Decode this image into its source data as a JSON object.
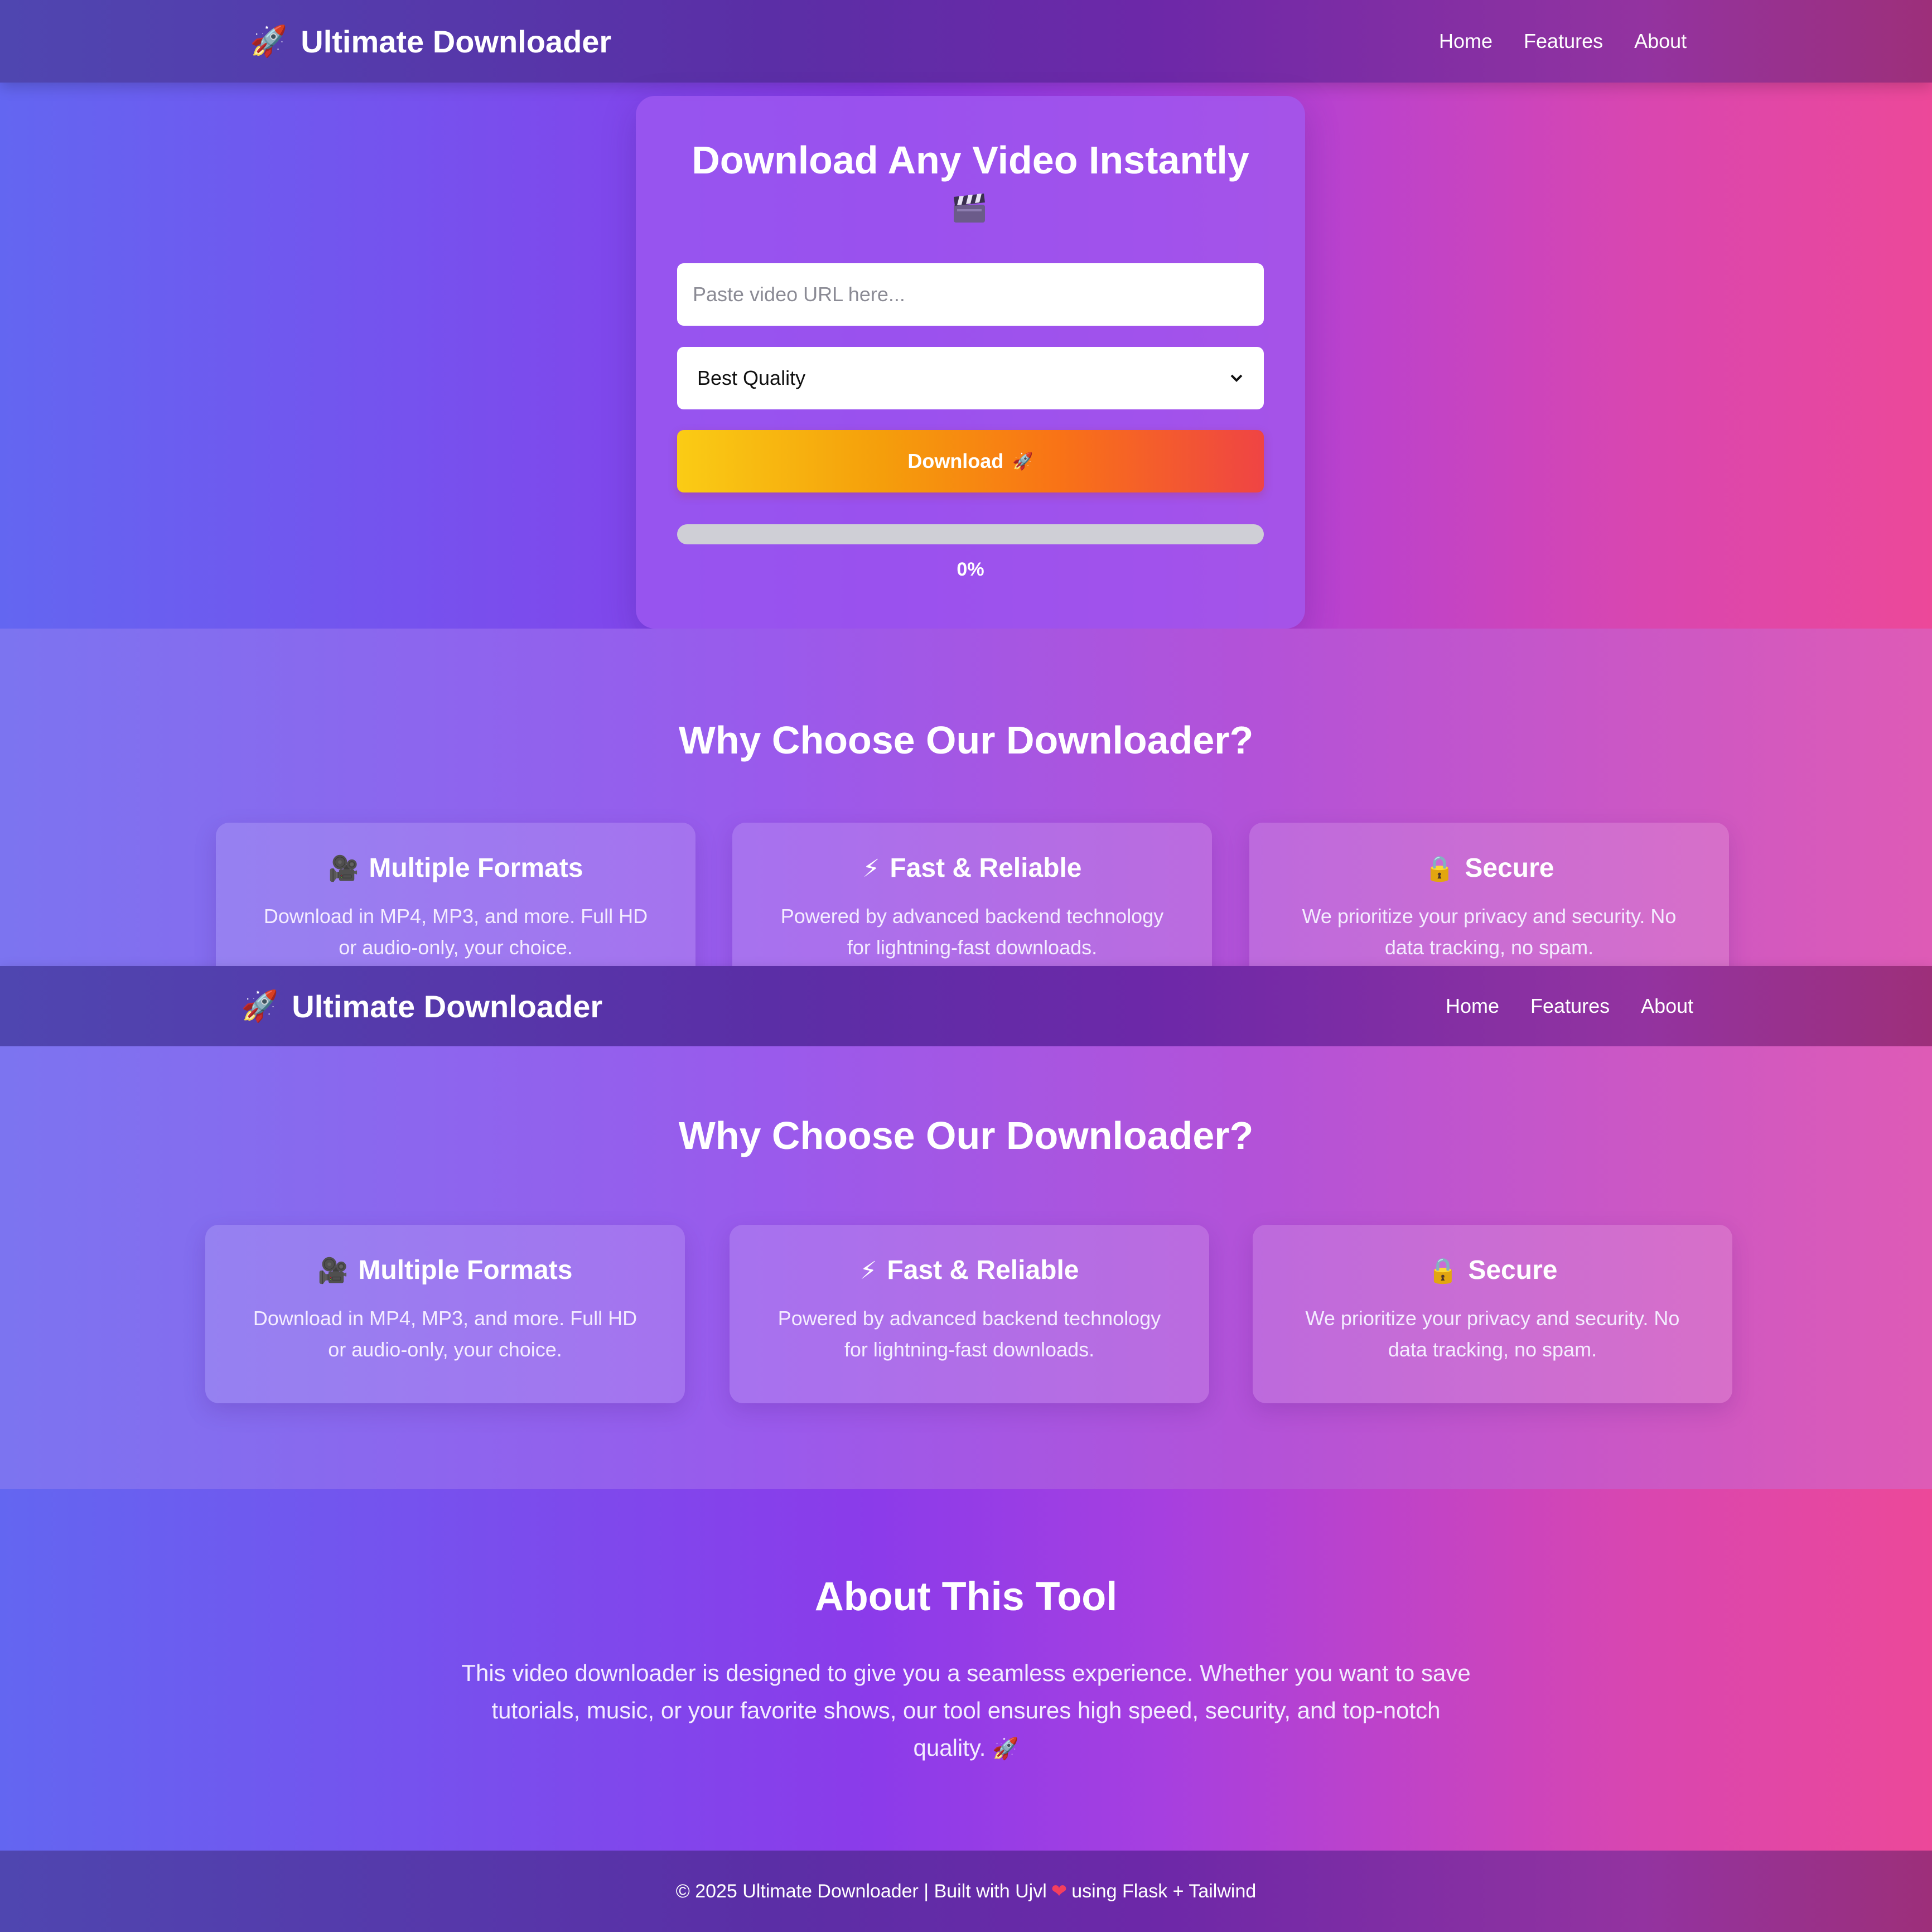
{
  "brand": {
    "name": "Ultimate Downloader",
    "icon": "rocket-icon"
  },
  "nav": {
    "links": [
      "Home",
      "Features",
      "About"
    ]
  },
  "hero": {
    "title": "Download Any Video Instantly",
    "title_icon": "clapperboard-icon",
    "url_placeholder": "Paste video URL here...",
    "quality_selected": "Best Quality",
    "download_label": "Download",
    "download_icon": "rocket-icon",
    "progress_label": "0%",
    "progress_value": 0
  },
  "features": {
    "title": "Why Choose Our Downloader?",
    "cards": [
      {
        "icon": "movie-camera-icon",
        "title": "Multiple Formats",
        "desc_line1": "Download in MP4, MP3, and more. Full HD",
        "desc_line2": "or audio-only, your choice."
      },
      {
        "icon": "lightning-icon",
        "title": "Fast & Reliable",
        "desc_line1": "Powered by advanced backend technology",
        "desc_line2": "for lightning-fast downloads."
      },
      {
        "icon": "lock-icon",
        "title": "Secure",
        "desc_line1": "We prioritize your privacy and security. No",
        "desc_line2": "data tracking, no spam."
      }
    ]
  },
  "about": {
    "title": "About This Tool",
    "line1": "This video downloader is designed to give you a seamless experience. Whether you want to save",
    "line2": "tutorials, music, or your favorite shows, our tool ensures high speed, security, and top-notch",
    "line3": "quality."
  },
  "footer": {
    "before_heart": "© 2025 Ultimate Downloader | Built with Ujvl",
    "after_heart": "using Flask + Tailwind"
  },
  "colors": {
    "accent_start": "#facc15",
    "accent_end": "#ef4444",
    "gradient_left": "#6366f1",
    "gradient_right": "#ec4899"
  }
}
